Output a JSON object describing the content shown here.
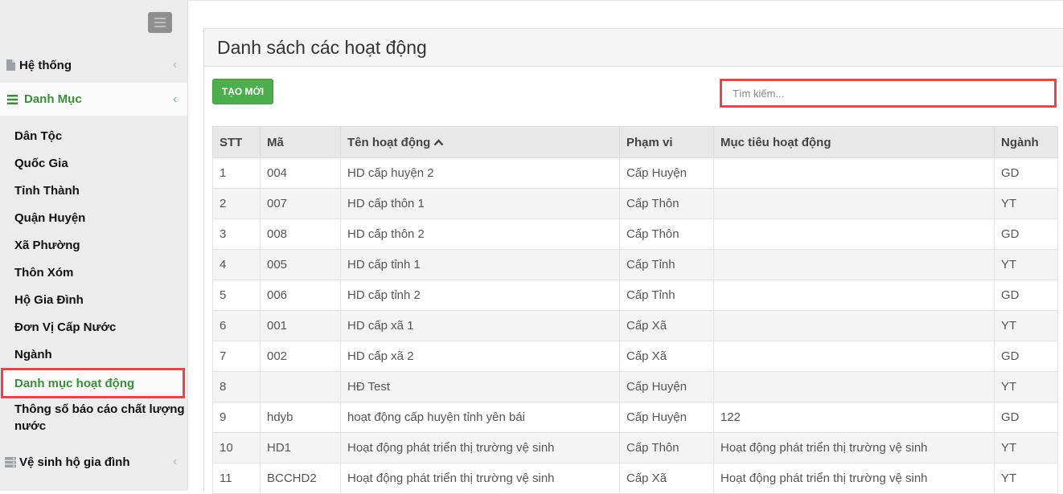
{
  "sidebar": {
    "menu": [
      {
        "label": "Hệ thống",
        "icon": "file-icon"
      },
      {
        "label": "Danh Mục",
        "icon": "list-icon"
      },
      {
        "label": "Vệ sinh hộ gia đình",
        "icon": "server-icon"
      }
    ],
    "submenu": [
      "Dân Tộc",
      "Quốc Gia",
      "Tỉnh Thành",
      "Quận Huyện",
      "Xã Phường",
      "Thôn Xóm",
      "Hộ Gia Đình",
      "Đơn Vị Cấp Nước",
      "Ngành",
      "Danh mục hoạt động",
      "Thông số báo cáo chất lượng nước"
    ],
    "active_item": "Danh mục hoạt động",
    "accent_color": "#3c8d3c"
  },
  "panel": {
    "title": "Danh sách các hoạt động",
    "create_button": "TẠO MỚI",
    "search_placeholder": "Tìm kiếm..."
  },
  "table": {
    "columns": [
      "STT",
      "Mã",
      "Tên hoạt động",
      "Phạm vi",
      "Mục tiêu hoạt động",
      "Ngành"
    ],
    "sorted_column": "Tên hoạt động",
    "rows": [
      [
        "1",
        "004",
        "HD cấp huyện 2",
        "Cấp Huyện",
        "",
        "GD"
      ],
      [
        "2",
        "007",
        "HD cấp thôn 1",
        "Cấp Thôn",
        "",
        "YT"
      ],
      [
        "3",
        "008",
        "HD cấp thôn 2",
        "Cấp Thôn",
        "",
        "GD"
      ],
      [
        "4",
        "005",
        "HD cấp tỉnh 1",
        "Cấp Tỉnh",
        "",
        "YT"
      ],
      [
        "5",
        "006",
        "HD cấp tỉnh 2",
        "Cấp Tỉnh",
        "",
        "GD"
      ],
      [
        "6",
        "001",
        "HD cấp xã 1",
        "Cấp Xã",
        "",
        "YT"
      ],
      [
        "7",
        "002",
        "HD cấp xã 2",
        "Cấp Xã",
        "",
        "GD"
      ],
      [
        "8",
        "",
        "HĐ Test",
        "Cấp Huyện",
        "",
        "YT"
      ],
      [
        "9",
        "hdyb",
        "hoạt động cấp huyện tỉnh yên bái",
        "Cấp Huyện",
        "122",
        "GD"
      ],
      [
        "10",
        "HD1",
        "Hoạt động phát triển thị trường vệ sinh",
        "Cấp Thôn",
        "Hoạt động phát triển thị trường vệ sinh",
        "YT"
      ],
      [
        "11",
        "BCCHD2",
        "Hoạt động phát triển thị trường vệ sinh",
        "Cấp Xã",
        "Hoạt động phát triển thị trường vệ sinh",
        "YT"
      ]
    ]
  }
}
